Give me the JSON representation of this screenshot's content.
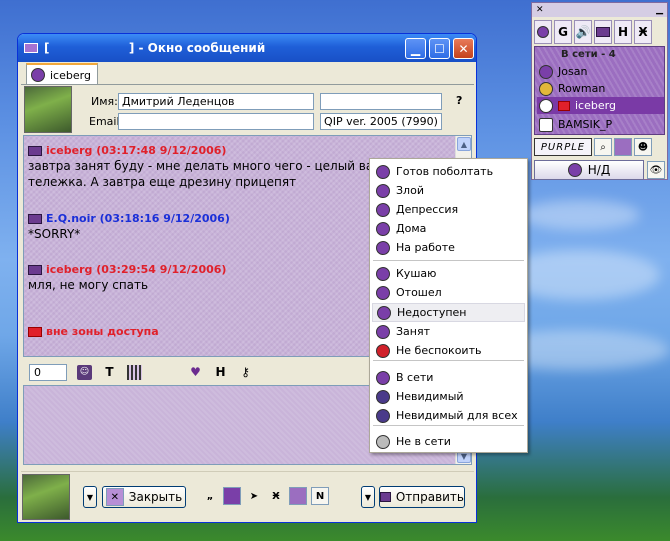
{
  "window": {
    "title": "[                   ] - Окно сообщений"
  },
  "tab": {
    "label": "iceberg"
  },
  "contact_info": {
    "name_label": "Имя:",
    "name_value": "Дмитрий  Леденцов",
    "email_label": "Email:",
    "email_value": "",
    "client_value": "QIP ver. 2005 (7990)",
    "help": "?"
  },
  "messages": [
    {
      "header": "iceberg (03:17:48 9/12/2006)",
      "color": "#e0202a",
      "lines": [
        "завтра занят буду - мне делать много чего - целый вагон",
        "тележка. А завтра еще дрезину прицепят"
      ]
    },
    {
      "header": "E.Q.noir (03:18:16 9/12/2006)",
      "color": "#1a2fd8",
      "lines": [
        "*SORRY*"
      ]
    },
    {
      "header": "iceberg (03:29:54 9/12/2006)",
      "color": "#e0202a",
      "lines": [
        "мля, не могу спать"
      ]
    },
    {
      "header": "вне зоны доступа",
      "color": "#e0202a",
      "lines": []
    }
  ],
  "toolbar": {
    "counter": "0",
    "text_btn": "T",
    "h_btn": "H"
  },
  "bottom": {
    "close_label": "Закрыть",
    "send_label": "Отправить",
    "quote_icon": "„",
    "n_btn": "N"
  },
  "contact_list": {
    "online_header": "В сети - 4",
    "contacts": [
      "Josan",
      "Rowman",
      "iceberg",
      "BAMSIK_P"
    ],
    "purple_label": "PURPLE",
    "status_label": "Н/Д",
    "toolbar": {
      "g": "G",
      "h": "H",
      "x": "Ӿ"
    }
  },
  "status_menu": {
    "items": [
      {
        "label": "Готов поболтать",
        "color": "#7a3fa8"
      },
      {
        "label": "Злой",
        "color": "#7a3fa8"
      },
      {
        "label": "Депрессия",
        "color": "#7a3fa8"
      },
      {
        "label": "Дома",
        "color": "#7a3fa8"
      },
      {
        "label": "На работе",
        "color": "#7a3fa8"
      },
      {
        "label": "Кушаю",
        "color": "#7a3fa8"
      },
      {
        "label": "Отошел",
        "color": "#7a3fa8"
      },
      {
        "label": "Недоступен",
        "color": "#7a3fa8"
      },
      {
        "label": "Занят",
        "color": "#7a3fa8"
      },
      {
        "label": "Не беспокоить",
        "color": "#d0202a"
      },
      {
        "label": "В сети",
        "color": "#7a3fa8"
      },
      {
        "label": "Невидимый",
        "color": "#4a3a8a"
      },
      {
        "label": "Невидимый для всех",
        "color": "#4a3a8a"
      },
      {
        "label": "Не в сети",
        "color": "#bbbbbb"
      }
    ],
    "highlighted": "Недоступен"
  }
}
